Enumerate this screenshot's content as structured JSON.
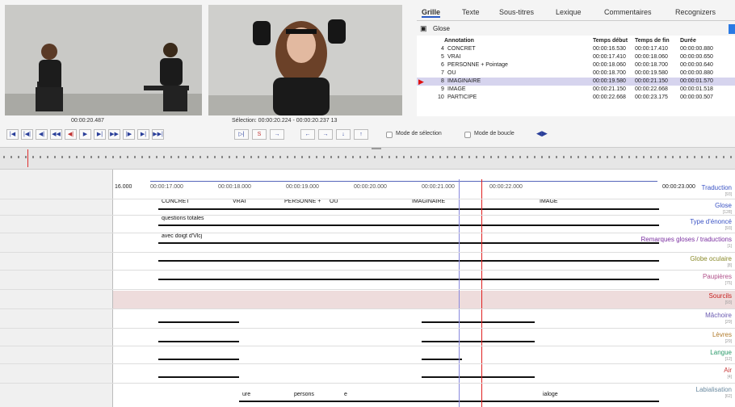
{
  "video": {
    "timecode": "00:00:20.487",
    "selection": "Sélection: 00:00:20.224 - 00:00:20.237  13"
  },
  "controls": {
    "buttons": [
      "|◀",
      "|◀|",
      "◀|",
      "◀◀",
      "◀|",
      "▶",
      "▶|",
      "▶▶",
      "|▶",
      "▶|",
      "▶▶|"
    ],
    "sel_buttons": [
      "▷|",
      "S",
      "→",
      "←",
      "→",
      "↓",
      "↑"
    ],
    "mode_selection": "Mode de sélection",
    "mode_boucle": "Mode de boucle"
  },
  "tabs": [
    "Grille",
    "Texte",
    "Sous-titres",
    "Lexique",
    "Commentaires",
    "Recognizers"
  ],
  "tier_selected": "Glose",
  "table": {
    "headers": [
      "Annotation",
      "Temps début",
      "Temps de fin",
      "Durée"
    ],
    "rows": [
      {
        "n": "4",
        "label": "CONCRET",
        "start": "00:00:16.530",
        "end": "00:00:17.410",
        "dur": "00:00:00.880"
      },
      {
        "n": "5",
        "label": "VRAI",
        "start": "00:00:17.410",
        "end": "00:00:18.060",
        "dur": "00:00:00.650"
      },
      {
        "n": "6",
        "label": "PERSONNE + Pointage",
        "start": "00:00:18.060",
        "end": "00:00:18.700",
        "dur": "00:00:00.640"
      },
      {
        "n": "7",
        "label": "OU",
        "start": "00:00:18.700",
        "end": "00:00:19.580",
        "dur": "00:00:00.880"
      },
      {
        "n": "8",
        "label": "IMAGINAIRE",
        "start": "00:00:19.580",
        "end": "00:00:21.150",
        "dur": "00:00:01.570"
      },
      {
        "n": "9",
        "label": "IMAGE",
        "start": "00:00:21.150",
        "end": "00:00:22.668",
        "dur": "00:00:01.518"
      },
      {
        "n": "10",
        "label": "PARTICIPE",
        "start": "00:00:22.668",
        "end": "00:00:23.175",
        "dur": "00:00:00.507"
      }
    ]
  },
  "ruler": {
    "start": "16.000",
    "t1": "00:00:17.000",
    "t2": "00:00:18.000",
    "t3": "00:00:19.000",
    "t4": "00:00:20.000",
    "t5": "00:00:21.000",
    "t6": "00:00:22.000",
    "end": "00:00:23.000"
  },
  "tiers": [
    {
      "name": "Traduction",
      "count": "[93]",
      "color": "#3a52c4"
    },
    {
      "name": "Glose",
      "count": "[128]",
      "color": "#3a52c4"
    },
    {
      "name": "Type d'énoncé",
      "count": "[93]",
      "color": "#3a52c4"
    },
    {
      "name": "Remarques gloses / traductions",
      "count": "[1]",
      "color": "#7a2fa0"
    },
    {
      "name": "Globe oculaire",
      "count": "[8]",
      "color": "#8a8a2a"
    },
    {
      "name": "Paupières",
      "count": "[75]",
      "color": "#b0508a"
    },
    {
      "name": "Sourcils",
      "count": "[93]",
      "color": "#c82020"
    },
    {
      "name": "Mâchoire",
      "count": "[29]",
      "color": "#6a5ab0"
    },
    {
      "name": "Lèvres",
      "count": "[29]",
      "color": "#b07a2a"
    },
    {
      "name": "Langue",
      "count": "[12]",
      "color": "#2a9a6a"
    },
    {
      "name": "Air",
      "count": "[4]",
      "color": "#c83a3a"
    },
    {
      "name": "Labialisation",
      "count": "[62]",
      "color": "#6a8aa0"
    }
  ],
  "segments": {
    "glose": [
      "CONCRET",
      "VRAI",
      "PERSONNE + ",
      "OU",
      "IMAGINAIRE",
      "IMAGE"
    ],
    "type": "questions totales",
    "remarques": "avec doigt d'Vlcj",
    "labial": [
      "ure",
      "persons",
      "e",
      "ialoge"
    ]
  }
}
